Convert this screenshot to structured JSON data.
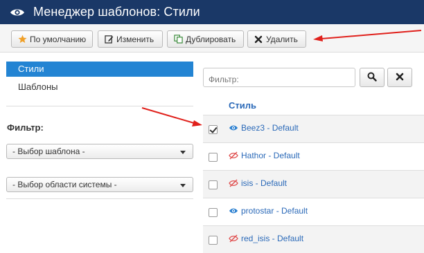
{
  "header": {
    "title": "Менеджер шаблонов: Стили",
    "icon": "eye-icon"
  },
  "toolbar": {
    "default_label": "По умолчанию",
    "edit_label": "Изменить",
    "duplicate_label": "Дублировать",
    "delete_label": "Удалить"
  },
  "sidebar": {
    "items": [
      {
        "label": "Стили",
        "active": true
      },
      {
        "label": "Шаблоны",
        "active": false
      }
    ],
    "filter_title": "Фильтр:",
    "selects": [
      {
        "value": "- Выбор шаблона -"
      },
      {
        "value": "- Выбор области системы -"
      }
    ]
  },
  "main": {
    "search_placeholder": "Фильтр:",
    "column_header": "Стиль",
    "rows": [
      {
        "name": "Beez3 - Default",
        "checked": true,
        "visible": true
      },
      {
        "name": "Hathor - Default",
        "checked": false,
        "visible": false
      },
      {
        "name": "isis - Default",
        "checked": false,
        "visible": false
      },
      {
        "name": "protostar - Default",
        "checked": false,
        "visible": true
      },
      {
        "name": "red_isis - Default",
        "checked": false,
        "visible": false
      }
    ]
  },
  "colors": {
    "header_bg": "#1a3867",
    "accent": "#2384d3",
    "link": "#2a69b8",
    "arrow": "#e0201b",
    "star": "#f0a028"
  }
}
